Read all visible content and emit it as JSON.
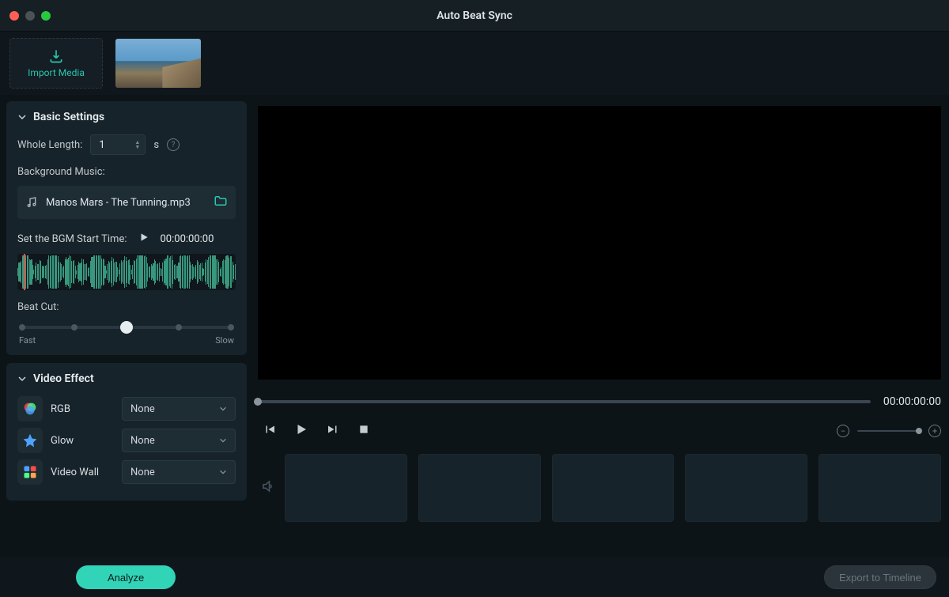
{
  "window": {
    "title": "Auto Beat Sync"
  },
  "import": {
    "label": "Import Media"
  },
  "settings": {
    "header": "Basic Settings",
    "whole_length_label": "Whole Length:",
    "whole_length_value": "1",
    "whole_length_unit": "s",
    "bg_music_label": "Background Music:",
    "bg_music_file": "Manos Mars - The Tunning.mp3",
    "bgm_start_label": "Set the BGM Start Time:",
    "bgm_start_tc": "00:00:00:00",
    "beat_cut_label": "Beat Cut:",
    "beat_cut_fast": "Fast",
    "beat_cut_slow": "Slow"
  },
  "effects": {
    "header": "Video Effect",
    "items": [
      {
        "name": "RGB",
        "value": "None"
      },
      {
        "name": "Glow",
        "value": "None"
      },
      {
        "name": "Video Wall",
        "value": "None"
      }
    ]
  },
  "preview": {
    "tc": "00:00:00:00"
  },
  "footer": {
    "analyze": "Analyze",
    "export": "Export to Timeline"
  }
}
